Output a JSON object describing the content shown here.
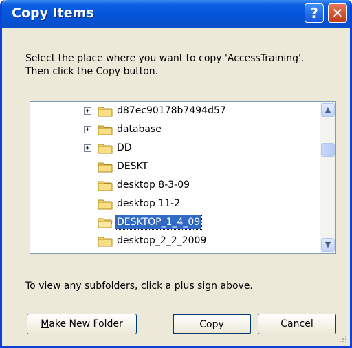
{
  "dialog": {
    "title": "Copy Items",
    "help_glyph": "?",
    "close_glyph": "✕",
    "instruction_line1": "Select the place where you want to copy 'AccessTraining'.",
    "instruction_line2": "Then click the Copy button.",
    "hint": "To view any subfolders, click a plus sign above."
  },
  "tree": {
    "items": [
      {
        "label": "d87ec90178b7494d57",
        "expandable": true,
        "selected": false
      },
      {
        "label": "database",
        "expandable": true,
        "selected": false
      },
      {
        "label": "DD",
        "expandable": true,
        "selected": false
      },
      {
        "label": "DESKT",
        "expandable": false,
        "selected": false
      },
      {
        "label": "desktop 8-3-09",
        "expandable": false,
        "selected": false
      },
      {
        "label": "desktop 11-2",
        "expandable": false,
        "selected": false
      },
      {
        "label": "DESKTOP_1_4_09",
        "expandable": false,
        "selected": true
      },
      {
        "label": "desktop_2_2_2009",
        "expandable": false,
        "selected": false
      }
    ],
    "plus_glyph": "+",
    "scroll_up_glyph": "▲",
    "scroll_down_glyph": "▼"
  },
  "buttons": {
    "make_new_folder_mnemonic": "M",
    "make_new_folder_rest": "ake New Folder",
    "copy": "Copy",
    "cancel": "Cancel"
  },
  "colors": {
    "title_bar": "#0554d8",
    "selection": "#316ac5",
    "dialog_bg": "#ece9d8"
  }
}
